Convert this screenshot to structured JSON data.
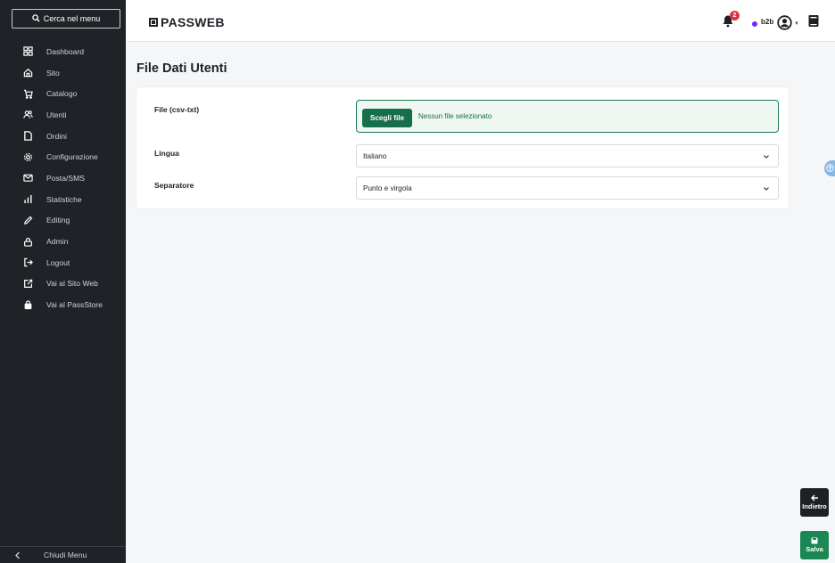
{
  "sidebar": {
    "search_label": "Cerca nel menu",
    "items": [
      {
        "label": "Dashboard",
        "icon": "grid-icon"
      },
      {
        "label": "Sito",
        "icon": "home-icon"
      },
      {
        "label": "Catalogo",
        "icon": "cart-icon"
      },
      {
        "label": "Utenti",
        "icon": "users-icon"
      },
      {
        "label": "Ordini",
        "icon": "document-icon"
      },
      {
        "label": "Configurazione",
        "icon": "gear-icon"
      },
      {
        "label": "Posta/SMS",
        "icon": "mail-icon"
      },
      {
        "label": "Statistiche",
        "icon": "bar-chart-icon"
      },
      {
        "label": "Editing",
        "icon": "pencil-icon"
      },
      {
        "label": "Admin",
        "icon": "lock-icon"
      },
      {
        "label": "Logout",
        "icon": "logout-icon"
      },
      {
        "label": "Vai al Sito Web",
        "icon": "external-link-icon"
      },
      {
        "label": "Vai al PassStore",
        "icon": "bag-icon"
      }
    ],
    "collapse_label": "Chiudi Menu"
  },
  "header": {
    "logo_text": "PASSWEB",
    "notifications_count": "2",
    "store_label": "b2b",
    "status_color": "#6f2cf5"
  },
  "main": {
    "title": "File Dati Utenti",
    "form": {
      "file_label": "File (csv-txt)",
      "file_button": "Scegli file",
      "file_status": "Nessun file selezionato",
      "lingua_label": "Lingua",
      "lingua_value": "Italiano",
      "separatore_label": "Separatore",
      "separatore_value": "Punto e virgola"
    }
  },
  "actions": {
    "back_label": "Indietro",
    "save_label": "Salva"
  },
  "colors": {
    "sidebar_bg": "#1f2328",
    "accent_green": "#176e4b",
    "save_green": "#1a8754",
    "badge_red": "#dc3545"
  }
}
